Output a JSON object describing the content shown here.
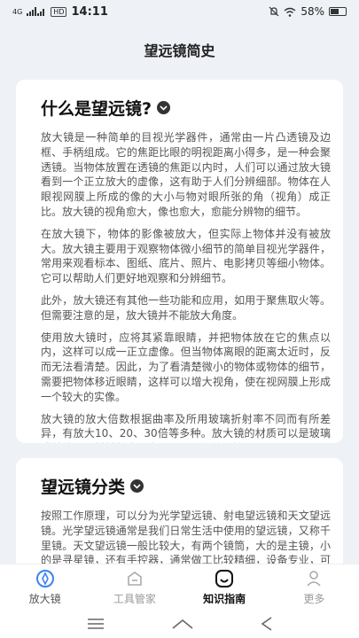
{
  "status": {
    "signal_4g": "4G",
    "time": "14:11",
    "hd": "HD",
    "battery": "58%",
    "battery_level": 0.58
  },
  "header": {
    "title": "望远镜简史"
  },
  "section1": {
    "title": "什么是望远镜?",
    "paragraphs": [
      "放大镜是一种简单的目视光学器件，通常由一片凸透镜及边框、手柄组成。它的焦距比眼的明视距离小得多，是一种会聚透镜。当物体放置在透镜的焦距以内时，人们可以通过放大镜看到一个正立放大的虚像，这有助于人们分辨细部。物体在人眼视网膜上所成的像的大小与物对眼所张的角（视角）成正比。放大镜的视角愈大，像也愈大，愈能分辨物的细节。",
      "在放大镜下，物体的影像被放大，但实际上物体并没有被放大。放大镜主要用于观察物体微小细节的简单目视光学器件，常用来观看标本、图纸、底片、照片、电影拷贝等细小物体。它可以帮助人们更好地观察和分辨细节。",
      "此外，放大镜还有其他一些功能和应用，如用于聚焦取火等。但需要注意的是，放大镜并不能放大角度。",
      "使用放大镜时，应将其紧靠眼睛，并把物体放在它的焦点以内，这样可以成一正立虚像。但当物体离眼的距离太近时，反而无法看清楚。因此，为了看清楚微小的物体或物体的细节，需要把物体移近眼睛，这样可以增大视角，使在视网膜上形成一个较大的实像。",
      "放大镜的放大倍数根据曲率及所用玻璃折射率不同而有所差异，有放大10、20、30倍等多种。放大镜的材质可以是玻璃或其他透明材料制成，表面平滑且连着透镜。"
    ]
  },
  "section2": {
    "title": "望远镜分类",
    "paragraphs": [
      "按照工作原理，可以分为光学望远镜、射电望远镜和天文望远镜。光学望远镜通常是我们日常生活中使用的望远镜，又称千里镜。天文望远镜一般比较大，有两个镜筒，大的是主镜，小的是寻星镜，还有手控器，通常做工比较精细，设备专业，可以连接手机、"
    ]
  },
  "nav": {
    "items": [
      {
        "label": "放大镜",
        "icon": "magnifier-icon"
      },
      {
        "label": "工具管家",
        "icon": "toolbox-icon"
      },
      {
        "label": "知识指南",
        "icon": "guide-icon"
      },
      {
        "label": "更多",
        "icon": "person-icon"
      }
    ],
    "active": "知识指南"
  },
  "colors": {
    "background": "#eef1f6",
    "card": "#ffffff",
    "accent": "#3b82f6"
  }
}
